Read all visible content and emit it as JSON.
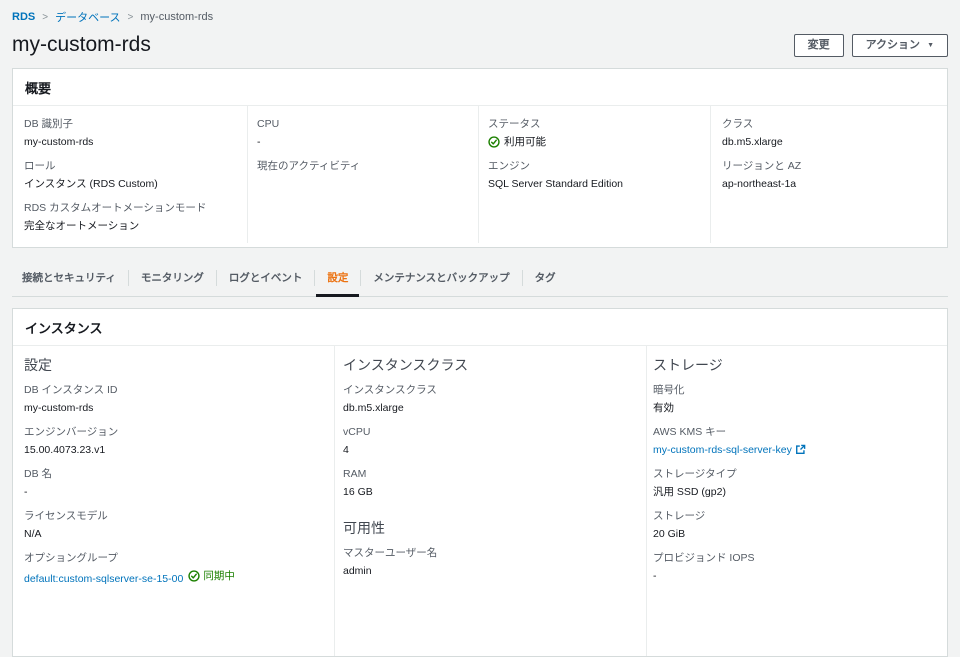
{
  "breadcrumb": {
    "items": [
      "RDS",
      "データベース",
      "my-custom-rds"
    ]
  },
  "icons": {
    "breadcrumb_separator": ">",
    "caret_down": "▼"
  },
  "header": {
    "title": "my-custom-rds",
    "modify_button": "変更",
    "actions_button": "アクション"
  },
  "colors": {
    "link_blue": "#0073bb",
    "status_green": "#1d8102",
    "active_tab_orange": "#ec7211",
    "page_background": "#f2f3f3"
  },
  "summary": {
    "title": "概要",
    "db_identifier": {
      "label": "DB 識別子",
      "value": "my-custom-rds"
    },
    "role": {
      "label": "ロール",
      "value": "インスタンス (RDS Custom)"
    },
    "automation_mode": {
      "label": "RDS カスタムオートメーションモード",
      "value": "完全なオートメーション"
    },
    "cpu": {
      "label": "CPU",
      "value": "-"
    },
    "current_activity": {
      "label": "現在のアクティビティ",
      "value": ""
    },
    "status": {
      "label": "ステータス",
      "value": "利用可能"
    },
    "engine": {
      "label": "エンジン",
      "value": "SQL Server Standard Edition"
    },
    "class": {
      "label": "クラス",
      "value": "db.m5.xlarge"
    },
    "region_az": {
      "label": "リージョンと AZ",
      "value": "ap-northeast-1a"
    }
  },
  "tabs": {
    "items": [
      "接続とセキュリティ",
      "モニタリング",
      "ログとイベント",
      "設定",
      "メンテナンスとバックアップ",
      "タグ"
    ],
    "active": "設定"
  },
  "instance_panel": {
    "title": "インスタンス",
    "config": {
      "heading": "設定",
      "db_instance_id": {
        "label": "DB インスタンス ID",
        "value": "my-custom-rds"
      },
      "engine_version": {
        "label": "エンジンバージョン",
        "value": "15.00.4073.23.v1"
      },
      "db_name": {
        "label": "DB 名",
        "value": "-"
      },
      "license_model": {
        "label": "ライセンスモデル",
        "value": "N/A"
      },
      "option_group": {
        "label": "オプショングループ",
        "link": "default:custom-sqlserver-se-15-00",
        "status": "同期中"
      }
    },
    "instance_class": {
      "heading": "インスタンスクラス",
      "instance_class": {
        "label": "インスタンスクラス",
        "value": "db.m5.xlarge"
      },
      "vcpu": {
        "label": "vCPU",
        "value": "4"
      },
      "ram": {
        "label": "RAM",
        "value": "16 GB"
      }
    },
    "availability": {
      "heading": "可用性",
      "master_username": {
        "label": "マスターユーザー名",
        "value": "admin"
      }
    },
    "storage": {
      "heading": "ストレージ",
      "encryption": {
        "label": "暗号化",
        "value": "有効"
      },
      "kms_key": {
        "label": "AWS KMS キー",
        "link": "my-custom-rds-sql-server-key"
      },
      "storage_type": {
        "label": "ストレージタイプ",
        "value": "汎用 SSD (gp2)"
      },
      "storage_size": {
        "label": "ストレージ",
        "value": "20 GiB"
      },
      "provisioned_iops": {
        "label": "プロビジョンド IOPS",
        "value": "-"
      }
    }
  }
}
